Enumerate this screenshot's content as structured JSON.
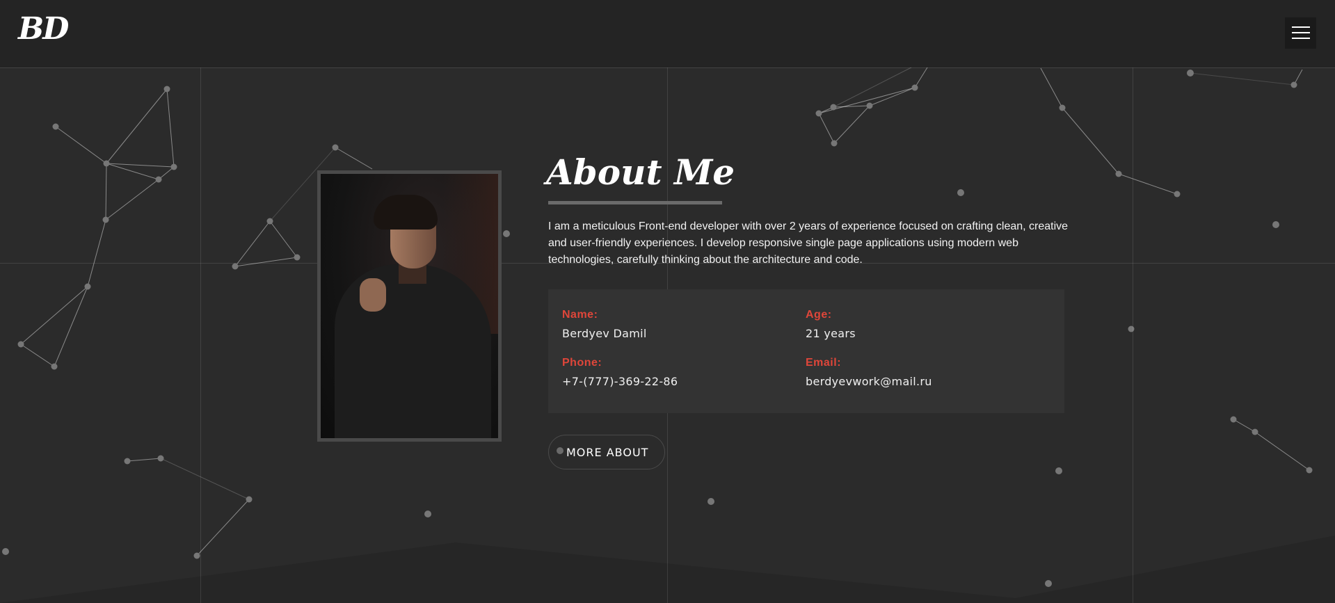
{
  "header": {
    "logo": "BD",
    "menu_icon": "hamburger-menu-icon"
  },
  "about": {
    "title": "About Me",
    "description": "I am a meticulous Front-end developer with over 2 years of experience focused on crafting clean, creative and user-friendly experiences. I develop responsive single page applications using modern web technologies, carefully thinking about the architecture and code.",
    "photo_alt": "portrait photo"
  },
  "info": {
    "name_label": "Name:",
    "name_value": "Berdyev Damil",
    "age_label": "Age:",
    "age_value": "21 years",
    "phone_label": "Phone:",
    "phone_value": "+7-(777)-369-22-86",
    "email_label": "Email:",
    "email_value": "berdyevwork@mail.ru"
  },
  "more_button": {
    "label": "MORE ABOUT"
  },
  "colors": {
    "background": "#2b2b2b",
    "header": "#242424",
    "accent": "#e0463a",
    "info_box": "#333333"
  }
}
